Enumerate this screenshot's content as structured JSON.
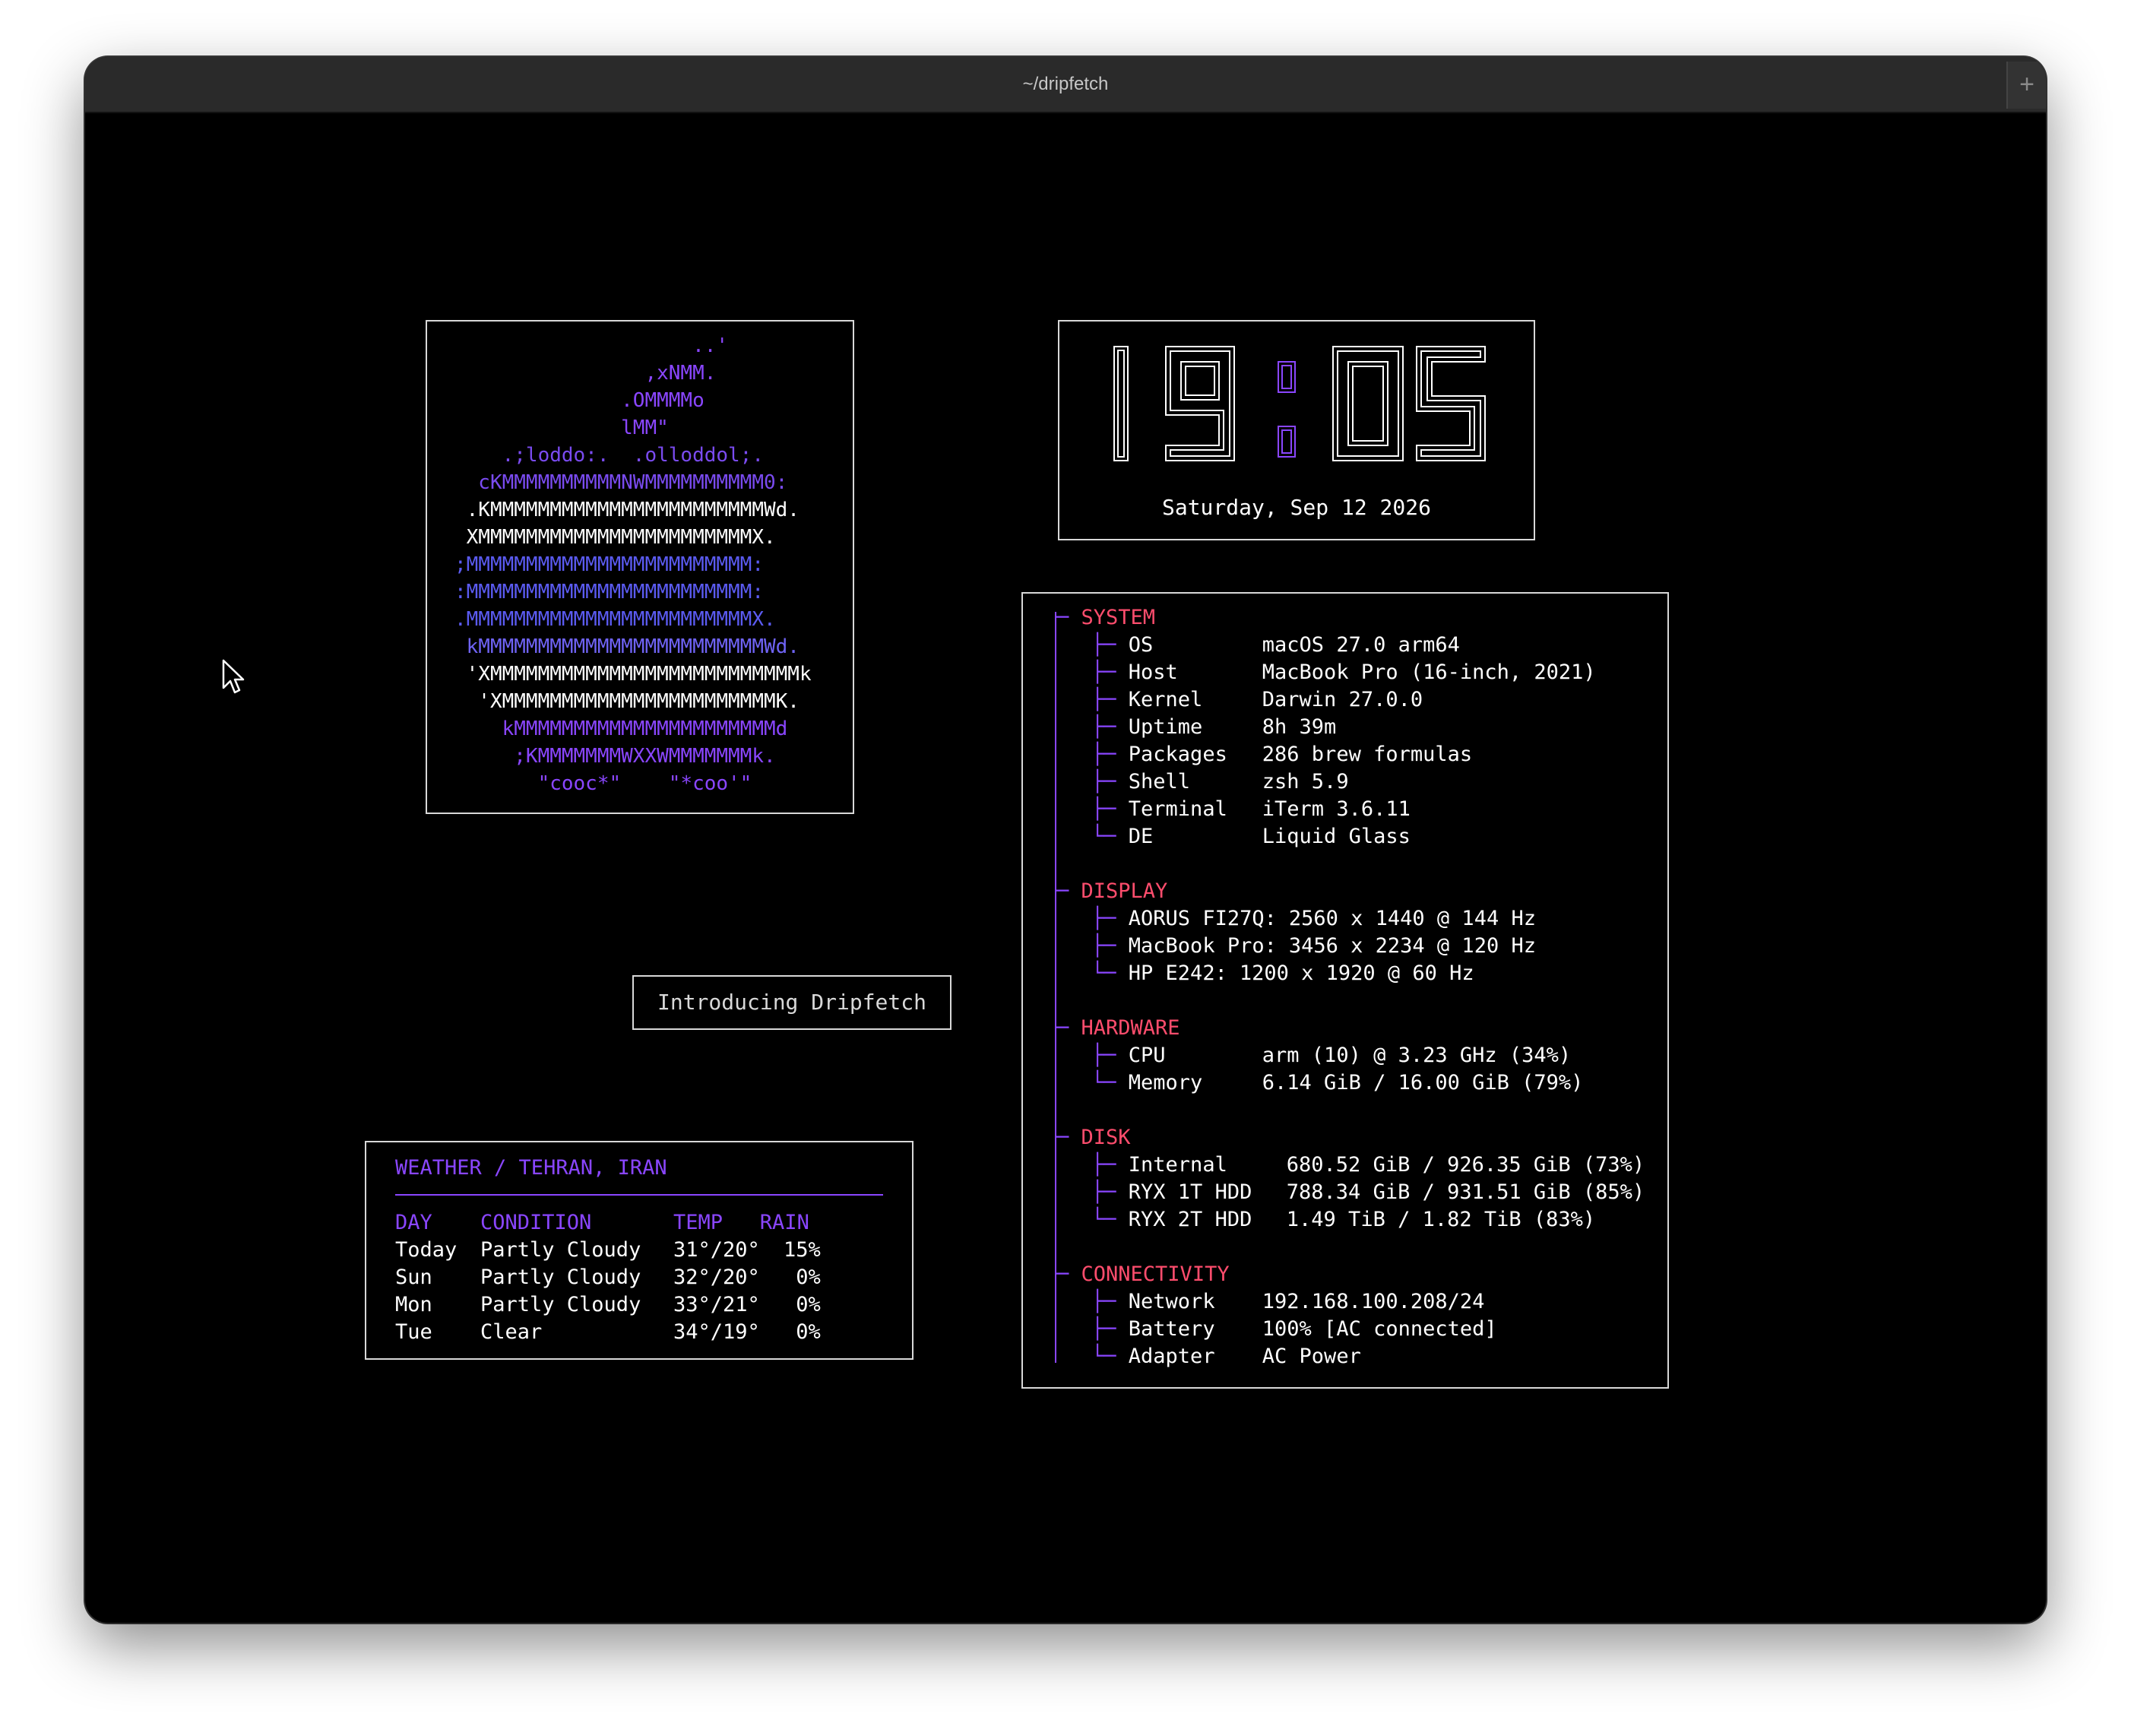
{
  "window": {
    "title": "~/dripfetch",
    "new_tab": "+"
  },
  "logo": {
    "lines": [
      {
        "text": "                    ..'",
        "color": "p1"
      },
      {
        "text": "                ,xNMM.",
        "color": "p1"
      },
      {
        "text": "              .OMMMMo",
        "color": "p1"
      },
      {
        "text": "              lMM\"",
        "color": "p1"
      },
      {
        "text": "    .;loddo:.  .olloddol;.",
        "color": "p2"
      },
      {
        "text": "  cKMMMMMMMMMMNWMMMMMMMMMM0:",
        "color": "p2"
      },
      {
        "text": " .KMMMMMMMMMMMMMMMMMMMMMMMWd.",
        "color": "w"
      },
      {
        "text": " XMMMMMMMMMMMMMMMMMMMMMMMX.",
        "color": "w"
      },
      {
        "text": ";MMMMMMMMMMMMMMMMMMMMMMMM:",
        "color": "b1"
      },
      {
        "text": ":MMMMMMMMMMMMMMMMMMMMMMMM:",
        "color": "b1"
      },
      {
        "text": ".MMMMMMMMMMMMMMMMMMMMMMMMX.",
        "color": "b1"
      },
      {
        "text": " kMMMMMMMMMMMMMMMMMMMMMMMMWd.",
        "color": "b2"
      },
      {
        "text": " 'XMMMMMMMMMMMMMMMMMMMMMMMMMMk",
        "color": "w"
      },
      {
        "text": "  'XMMMMMMMMMMMMMMMMMMMMMMMK.",
        "color": "w"
      },
      {
        "text": "    kMMMMMMMMMMMMMMMMMMMMMMd",
        "color": "p1"
      },
      {
        "text": "     ;KMMMMMMMWXXWMMMMMMMk.",
        "color": "p1"
      },
      {
        "text": "       \"cooc*\"    \"*coo'\"",
        "color": "p1"
      }
    ]
  },
  "clock": {
    "time": "19:05",
    "date": "Saturday, Sep 12 2026"
  },
  "intro": {
    "label": "Introducing Dripfetch"
  },
  "weather": {
    "header": "WEATHER / TEHRAN, IRAN",
    "columns": [
      "DAY",
      "CONDITION",
      "TEMP",
      "RAIN"
    ],
    "rows": [
      [
        "Today",
        "Partly Cloudy",
        "31°/20°",
        "15%"
      ],
      [
        "Sun",
        "Partly Cloudy",
        "32°/20°",
        "0%"
      ],
      [
        "Mon",
        "Partly Cloudy",
        "33°/21°",
        "0%"
      ],
      [
        "Tue",
        "Clear",
        "34°/19°",
        "0%"
      ]
    ]
  },
  "sysinfo": {
    "sections": [
      {
        "title": "SYSTEM",
        "items": [
          {
            "label": "OS",
            "value": "macOS 27.0 arm64"
          },
          {
            "label": "Host",
            "value": "MacBook Pro (16-inch, 2021)"
          },
          {
            "label": "Kernel",
            "value": "Darwin 27.0.0"
          },
          {
            "label": "Uptime",
            "value": "8h 39m"
          },
          {
            "label": "Packages",
            "value": "286 brew formulas"
          },
          {
            "label": "Shell",
            "value": "zsh 5.9"
          },
          {
            "label": "Terminal",
            "value": "iTerm 3.6.11"
          },
          {
            "label": "DE",
            "value": "Liquid Glass"
          }
        ]
      },
      {
        "title": "DISPLAY",
        "items": [
          {
            "label": "AORUS FI27Q:",
            "value": "2560 x 1440 @ 144 Hz"
          },
          {
            "label": "MacBook Pro:",
            "value": "3456 x 2234 @ 120 Hz"
          },
          {
            "label": "HP E242:",
            "value": "1200 x 1920 @ 60 Hz"
          }
        ]
      },
      {
        "title": "HARDWARE",
        "items": [
          {
            "label": "CPU",
            "value": "arm (10) @ 3.23 GHz (34%)"
          },
          {
            "label": "Memory",
            "value": "6.14 GiB / 16.00 GiB (79%)"
          }
        ]
      },
      {
        "title": "DISK",
        "items": [
          {
            "label": "Internal",
            "value": "680.52 GiB / 926.35 GiB (73%)"
          },
          {
            "label": "RYX 1T HDD",
            "value": "788.34 GiB / 931.51 GiB (85%)"
          },
          {
            "label": "RYX 2T HDD",
            "value": "1.49 TiB / 1.82 TiB (83%)"
          }
        ]
      },
      {
        "title": "CONNECTIVITY",
        "items": [
          {
            "label": "Network",
            "value": "192.168.100.208/24"
          },
          {
            "label": "Battery",
            "value": "100% [AC connected]"
          },
          {
            "label": "Adapter",
            "value": "AC Power"
          }
        ]
      }
    ]
  },
  "colors": {
    "accent_purple": "#8a46ff",
    "section_red": "#ff4d6d",
    "background": "#000000",
    "border": "#d8d8d8"
  }
}
